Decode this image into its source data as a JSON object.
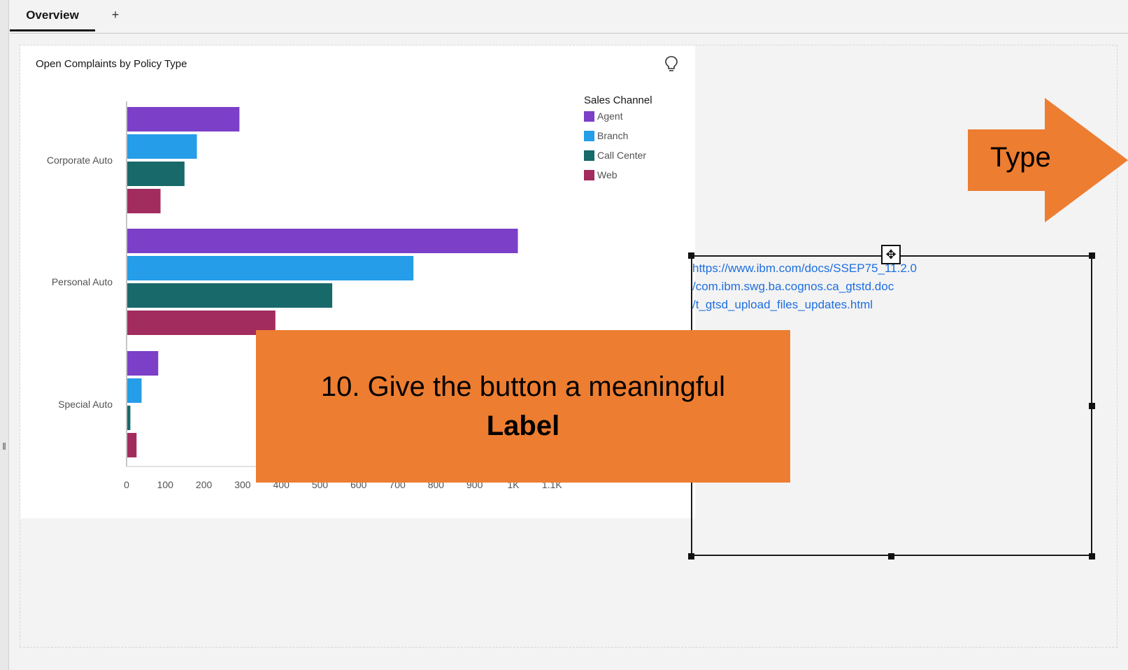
{
  "tabs": {
    "active_label": "Overview",
    "add_label": "+"
  },
  "widget": {
    "title": "Open Complaints by Policy Type"
  },
  "chart_data": {
    "type": "bar",
    "orientation": "horizontal",
    "title": "Open Complaints by Policy Type",
    "categories": [
      "Corporate Auto",
      "Personal Auto",
      "Special Auto"
    ],
    "series": [
      {
        "name": "Agent",
        "color": "#7b3fc8",
        "values": [
          290,
          1010,
          80
        ]
      },
      {
        "name": "Branch",
        "color": "#259de8",
        "values": [
          180,
          740,
          37
        ]
      },
      {
        "name": "Call Center",
        "color": "#18696a",
        "values": [
          148,
          530,
          8
        ]
      },
      {
        "name": "Web",
        "color": "#a32c5e",
        "values": [
          86,
          383,
          24
        ]
      }
    ],
    "xlim": [
      0,
      1100
    ],
    "xticks": [
      "0",
      "100",
      "200",
      "300",
      "400",
      "500",
      "600",
      "700",
      "800",
      "900",
      "1K",
      "1.1K"
    ],
    "legend_title": "Sales Channel",
    "legend_position": "top-right"
  },
  "text_box": {
    "url_lines": [
      "https://www.ibm.com/docs/SSEP75_11.2.0",
      "/com.ibm.swg.ba.cognos.ca_gtstd.doc",
      "/t_gtsd_upload_files_updates.html"
    ]
  },
  "callout": {
    "line1": "10. Give the button a meaningful",
    "line2": "Label",
    "color": "#ed7d31"
  },
  "arrow": {
    "label": "Type",
    "color": "#ed7d31"
  }
}
